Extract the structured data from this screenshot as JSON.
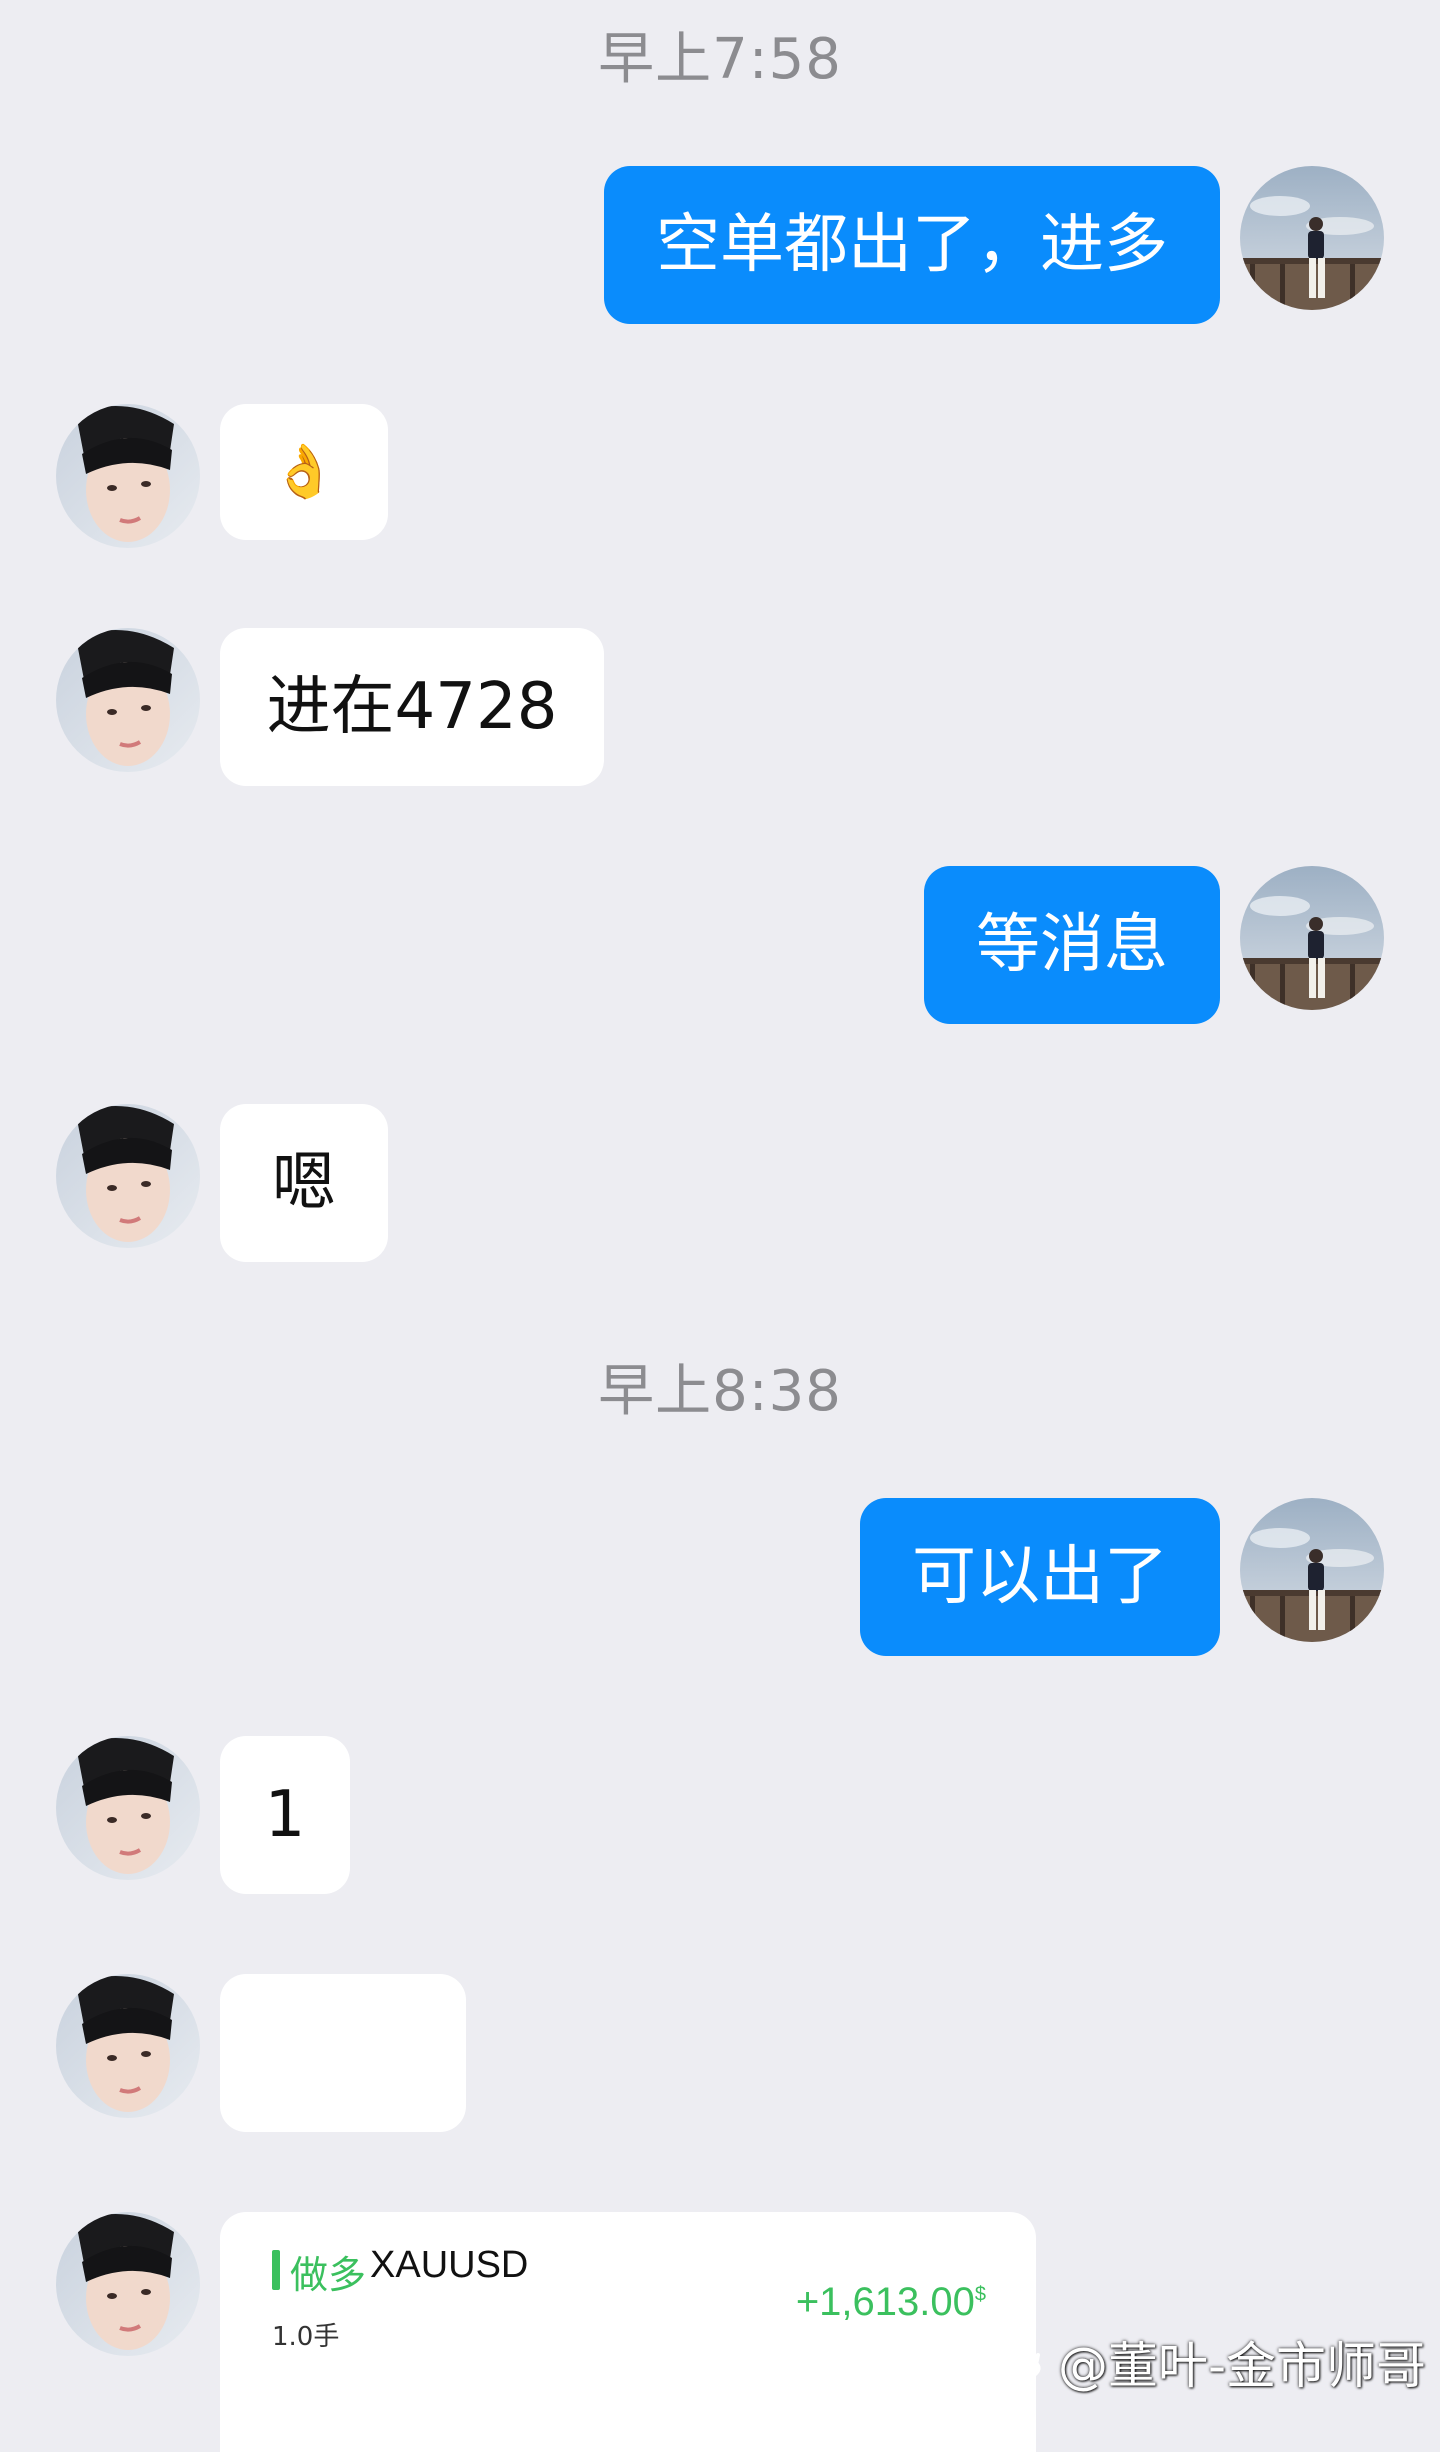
{
  "chat": {
    "timestamps": [
      "早上7:58",
      "早上8:38"
    ],
    "messages": [
      {
        "side": "out",
        "text": "空单都出了，进多"
      },
      {
        "side": "in",
        "text": "👌"
      },
      {
        "side": "in",
        "text": "进在4728"
      },
      {
        "side": "out",
        "text": "等消息"
      },
      {
        "side": "in",
        "text": "嗯"
      },
      {
        "side": "out",
        "text": "可以出了"
      },
      {
        "side": "in",
        "text": "1"
      },
      {
        "side": "in",
        "text": ""
      }
    ],
    "trade_card": {
      "direction": "做多",
      "symbol": "XAUUSD",
      "lots": "1.0手",
      "pnl": "+1,613.00",
      "currency": "$"
    }
  },
  "watermark": "@董叶-金市师哥",
  "colors": {
    "background": "#EDEDF2",
    "outgoing_bubble": "#0A8CFC",
    "incoming_bubble": "#FFFFFF",
    "profit_green": "#3BC05E",
    "timestamp_gray": "#8C8C90"
  },
  "icons": {
    "self_avatar": "avatar-man-on-railing",
    "contact_avatar": "avatar-young-man-selfie"
  }
}
